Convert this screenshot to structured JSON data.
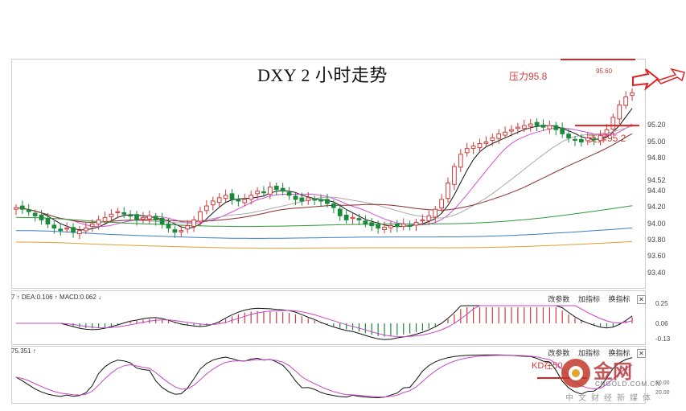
{
  "chart_data": {
    "type": "candlestick",
    "title": "DXY 2 小时走势",
    "xlabel": "",
    "ylabel": "",
    "ylim": [
      93.25,
      95.75
    ],
    "yticks": [
      "95.20",
      "95.00",
      "94.80",
      "94.52",
      "94.40",
      "94.20",
      "94.00",
      "93.80",
      "93.60",
      "93.40"
    ],
    "macd_yticks": [
      "0.25",
      "0.06",
      "-0.13"
    ],
    "kd_yticks": [
      "80.00",
      "20.00"
    ],
    "close": [
      94.2,
      94.18,
      94.15,
      94.1,
      94.05,
      94.0,
      93.95,
      93.92,
      93.95,
      93.9,
      93.92,
      93.95,
      94.0,
      94.05,
      94.08,
      94.12,
      94.15,
      94.12,
      94.1,
      94.05,
      94.08,
      94.1,
      94.05,
      94.0,
      93.95,
      93.9,
      93.92,
      93.98,
      94.05,
      94.15,
      94.22,
      94.28,
      94.32,
      94.35,
      94.3,
      94.28,
      94.3,
      94.35,
      94.4,
      94.38,
      94.45,
      94.42,
      94.4,
      94.35,
      94.3,
      94.28,
      94.32,
      94.3,
      94.28,
      94.25,
      94.2,
      94.1,
      94.05,
      94.08,
      94.05,
      94.0,
      93.98,
      93.95,
      93.96,
      93.98,
      93.97,
      94.0,
      93.98,
      94.02,
      94.05,
      94.1,
      94.18,
      94.3,
      94.5,
      94.7,
      94.85,
      94.92,
      94.95,
      94.98,
      95.0,
      95.05,
      95.1,
      95.12,
      95.15,
      95.18,
      95.2,
      95.22,
      95.2,
      95.18,
      95.2,
      95.15,
      95.1,
      95.05,
      95.02,
      95.0,
      95.05,
      95.03,
      95.08,
      95.15,
      95.3,
      95.45,
      95.55,
      95.6
    ],
    "series": [
      {
        "name": "MA5",
        "color": "#111111"
      },
      {
        "name": "MA10",
        "color": "#d54fd5"
      },
      {
        "name": "MA20",
        "color": "#aaaaaa"
      },
      {
        "name": "MA30",
        "color": "#8b2b2b"
      },
      {
        "name": "MA60",
        "color": "#2d9a3a"
      },
      {
        "name": "MA120",
        "color": "#3b7cc8"
      },
      {
        "name": "MA250",
        "color": "#e0a030"
      }
    ],
    "levels": {
      "resistance": 95.8,
      "support": 95.2,
      "high": 95.6
    }
  },
  "annotations": {
    "resistance": "压力95.8",
    "support": "支撑95.2",
    "high_value": "95.60",
    "kd_note": "KD在50"
  },
  "indicators": {
    "macd_legend": "7 ↑ DEA:0.106 ↑ MACD:0.062 ↓",
    "kd_legend": "75.351 ↑"
  },
  "toolbar": {
    "edit_params": "改参数",
    "add_indicator": "加指标",
    "switch_indicator": "换指标",
    "close_glyph": "✕"
  },
  "watermark": {
    "name": "金网",
    "domain": "CNGOLD.COM.CN",
    "slogan": "中文财经新媒体"
  },
  "colors": {
    "up": "#d23a3a",
    "down": "#1a8a3a",
    "accent": "#e02020"
  }
}
